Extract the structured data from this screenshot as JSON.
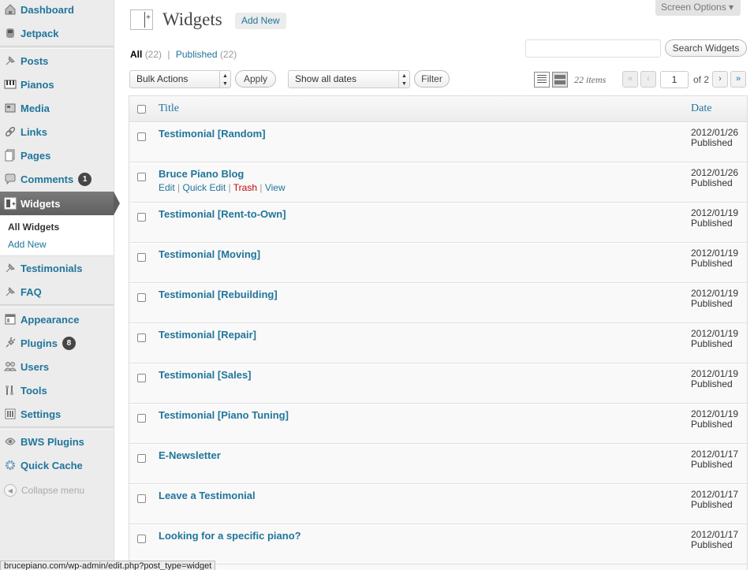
{
  "sidebar": {
    "items": [
      {
        "label": "Dashboard",
        "icon": "dashboard-icon"
      },
      {
        "label": "Jetpack",
        "icon": "jetpack-icon"
      },
      {
        "label": "Posts",
        "icon": "pin-icon"
      },
      {
        "label": "Pianos",
        "icon": "piano-keys-icon"
      },
      {
        "label": "Media",
        "icon": "media-icon"
      },
      {
        "label": "Links",
        "icon": "link-icon"
      },
      {
        "label": "Pages",
        "icon": "pages-icon"
      },
      {
        "label": "Comments",
        "icon": "comment-icon",
        "badge": "1"
      },
      {
        "label": "Widgets",
        "icon": "widget-icon"
      },
      {
        "label": "Testimonials",
        "icon": "pin-icon"
      },
      {
        "label": "FAQ",
        "icon": "pin-icon"
      },
      {
        "label": "Appearance",
        "icon": "appearance-icon"
      },
      {
        "label": "Plugins",
        "icon": "plug-icon",
        "badge": "8"
      },
      {
        "label": "Users",
        "icon": "users-icon"
      },
      {
        "label": "Tools",
        "icon": "tools-icon"
      },
      {
        "label": "Settings",
        "icon": "settings-icon"
      },
      {
        "label": "BWS Plugins",
        "icon": "bws-icon"
      },
      {
        "label": "Quick Cache",
        "icon": "gear-icon"
      }
    ],
    "submenu": {
      "all": "All Widgets",
      "add": "Add New"
    },
    "collapse": "Collapse menu"
  },
  "header": {
    "title": "Widgets",
    "add_new": "Add New",
    "screen_options": "Screen Options ▾"
  },
  "filters": {
    "all_label": "All",
    "all_count": "(22)",
    "sep": "|",
    "published_label": "Published",
    "published_count": "(22)",
    "search_button": "Search Widgets",
    "bulk_actions": "Bulk Actions",
    "apply": "Apply",
    "dates": "Show all dates",
    "filter": "Filter",
    "items_count": "22 items",
    "page": "1",
    "of_pages": "of 2",
    "first": "«",
    "prev": "‹",
    "next": "›",
    "last": "»"
  },
  "table": {
    "columns": {
      "title": "Title",
      "date": "Date"
    },
    "rows": [
      {
        "title": "Testimonial [Random]",
        "date": "2012/01/26",
        "status": "Published"
      },
      {
        "title": "Bruce Piano Blog",
        "date": "2012/01/26",
        "status": "Published",
        "actions": {
          "edit": "Edit",
          "quick_edit": "Quick Edit",
          "trash": "Trash",
          "view": "View",
          "sep": "|"
        }
      },
      {
        "title": "Testimonial [Rent-to-Own]",
        "date": "2012/01/19",
        "status": "Published"
      },
      {
        "title": "Testimonial [Moving]",
        "date": "2012/01/19",
        "status": "Published"
      },
      {
        "title": "Testimonial [Rebuilding]",
        "date": "2012/01/19",
        "status": "Published"
      },
      {
        "title": "Testimonial [Repair]",
        "date": "2012/01/19",
        "status": "Published"
      },
      {
        "title": "Testimonial [Sales]",
        "date": "2012/01/19",
        "status": "Published"
      },
      {
        "title": "Testimonial [Piano Tuning]",
        "date": "2012/01/19",
        "status": "Published"
      },
      {
        "title": "E-Newsletter",
        "date": "2012/01/17",
        "status": "Published"
      },
      {
        "title": "Leave a Testimonial",
        "date": "2012/01/17",
        "status": "Published"
      },
      {
        "title": "Looking for a specific piano?",
        "date": "2012/01/17",
        "status": "Published"
      }
    ]
  },
  "statusbar": "brucepiano.com/wp-admin/edit.php?post_type=widget",
  "colors": {
    "link": "#21759b",
    "trash": "#bc0b0b",
    "sidebar_bg": "#ececec",
    "active_menu": "#6d6d6d"
  }
}
